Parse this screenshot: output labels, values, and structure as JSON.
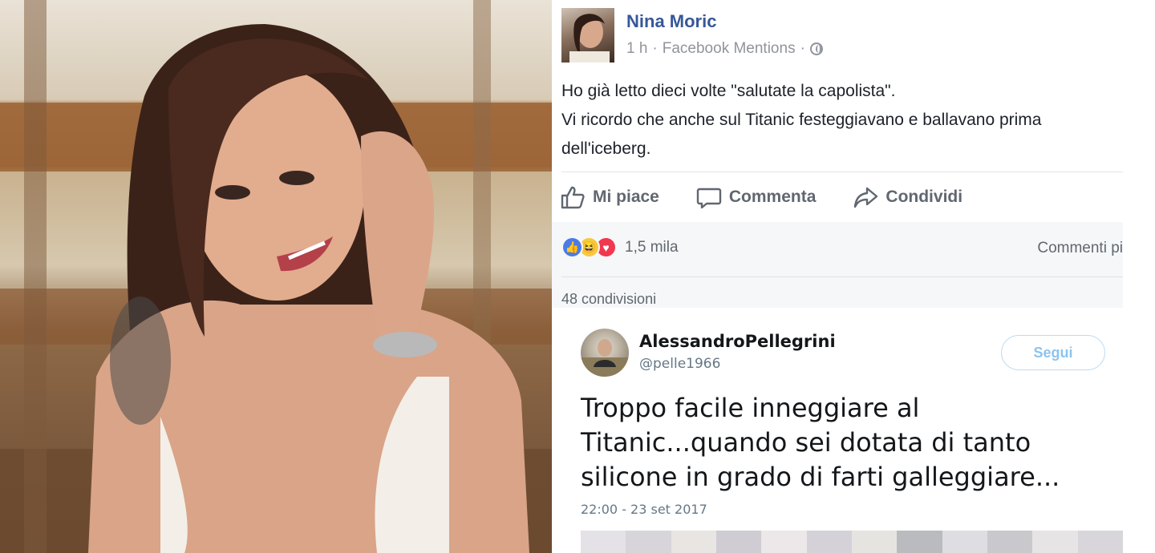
{
  "facebook_post": {
    "author_name": "Nina Moric",
    "meta_time": "1 h",
    "meta_separator": "·",
    "meta_source": "Facebook Mentions",
    "meta_separator2": "·",
    "text_line1": "Ho già letto dieci volte \"salutate la capolista\".",
    "text_line2": "Vi ricordo che anche sul Titanic festeggiavano e ballavano prima dell'iceberg.",
    "actions": {
      "like": "Mi piace",
      "comment": "Commenta",
      "share": "Condividi"
    },
    "reactions_count": "1,5 mila",
    "comments_link": "Commenti pi",
    "shares": "48 condivisioni",
    "icons": [
      "like-icon",
      "comment-icon",
      "share-icon",
      "globe-icon",
      "like-reaction-icon",
      "haha-reaction-icon",
      "love-reaction-icon"
    ]
  },
  "tweet": {
    "author_name": "AlessandroPellegrini",
    "handle": "@pelle1966",
    "follow_label": "Segui",
    "text": "Troppo facile inneggiare al Titanic...quando sei dotata di tanto silicone in grado di farti galleggiare...",
    "timestamp": "22:00 - 23 set 2017"
  },
  "colors": {
    "facebook_link": "#365899",
    "facebook_gray": "#606770",
    "twitter_follow": "#8cc4ee",
    "twitter_gray": "#657786",
    "reaction_like": "#4c7be5",
    "reaction_haha": "#f7c940",
    "reaction_love": "#f0384e"
  }
}
